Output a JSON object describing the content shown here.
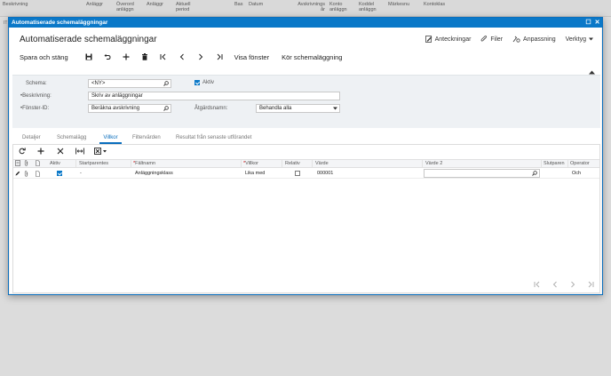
{
  "background": {
    "columns": [
      {
        "key": "c1",
        "label": "Beskrivning"
      },
      {
        "key": "c2",
        "label": "Anläggr"
      },
      {
        "key": "c3",
        "label": "Överord anläggn"
      },
      {
        "key": "c4",
        "label": "Anläggr"
      },
      {
        "key": "c5",
        "label": "Aktuell period"
      },
      {
        "key": "c6",
        "label": "Bas"
      },
      {
        "key": "c7",
        "label": "Datum"
      },
      {
        "key": "c8",
        "label": "Avskrivnings år"
      },
      {
        "key": "c9",
        "label": "Konto anläggn"
      },
      {
        "key": "c10",
        "label": "Koddel anläggn"
      },
      {
        "key": "c11",
        "label": "Märkesnu"
      },
      {
        "key": "c12",
        "label": "Kontoklas"
      }
    ],
    "row_prefix": "IT"
  },
  "window": {
    "title": "Automatiserade schemaläggningar",
    "maximize_glyph": "☐",
    "close_glyph": "✕"
  },
  "page": {
    "title": "Automatiserade schemaläggningar",
    "actions": {
      "notes": "Anteckningar",
      "files": "Filer",
      "customize": "Anpassning",
      "tools": "Verktyg"
    }
  },
  "toolbar": {
    "save_close": "Spara och stäng",
    "show_window": "Visa fönster",
    "run_schedule": "Kör schemaläggning"
  },
  "form": {
    "schema_label": "Schema:",
    "schema_value": "<NY>",
    "active_label": "Aktiv",
    "active_checked": true,
    "description_label": "Beskrivning:",
    "description_value": "Skriv av anläggningar",
    "window_id_label": "Fönster-ID:",
    "window_id_value": "Beräkna avskrivning",
    "action_name_label": "Åtgärdsnamn:",
    "action_name_value": "Behandla alla"
  },
  "tabs": [
    {
      "label": "Detaljer",
      "active": false
    },
    {
      "label": "Schemalägg",
      "active": false
    },
    {
      "label": "Villkor",
      "active": true
    },
    {
      "label": "Filtervärden",
      "active": false
    },
    {
      "label": "Resultat från senaste utförandet",
      "active": false
    }
  ],
  "grid": {
    "headers": {
      "active": "Aktiv",
      "start_paren": "Startparentes",
      "field_name": "Fältnamn",
      "condition": "Villkor",
      "relative": "Relativ",
      "value": "Värde",
      "value2": "Värde 2",
      "end_paren": "Slutparen",
      "operator": "Operator"
    },
    "rows": [
      {
        "active": true,
        "start_paren": "-",
        "field_name": "Anläggningsklass",
        "condition": "Lika med",
        "relative": false,
        "value": "000001",
        "value2": "",
        "end_paren": "",
        "operator": "Och"
      }
    ]
  },
  "colors": {
    "accent": "#0a78c8",
    "title_bar": "#0a78c8"
  }
}
